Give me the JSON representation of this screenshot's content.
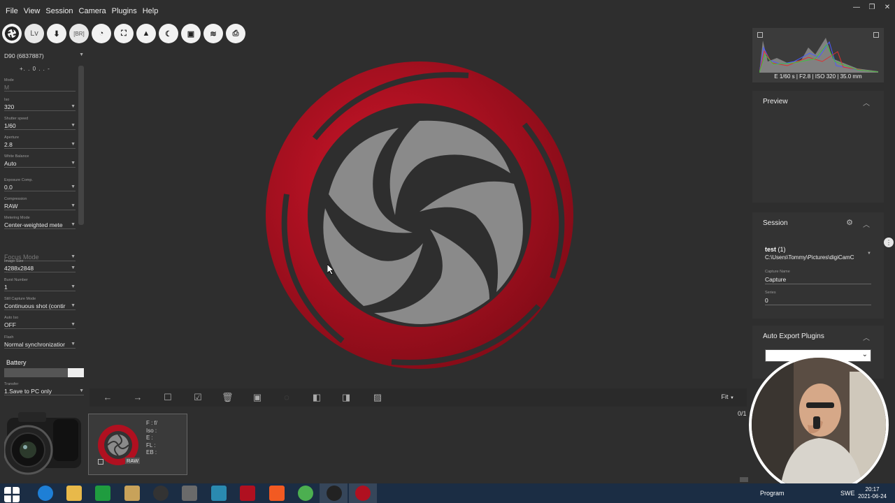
{
  "menu": [
    "File",
    "View",
    "Session",
    "Camera",
    "Plugins",
    "Help"
  ],
  "window_controls": [
    "—",
    "❐",
    "✕"
  ],
  "toolbar": {
    "items": [
      {
        "name": "capture-aperture-icon",
        "label": ""
      },
      {
        "name": "liveview-button",
        "label": "Lv"
      },
      {
        "name": "download-icon",
        "label": "⬇"
      },
      {
        "name": "bracketing-button",
        "label": "[BR]"
      },
      {
        "name": "timelapse-icon",
        "label": "◔"
      },
      {
        "name": "fullscreen-icon",
        "label": "⛶"
      },
      {
        "name": "image-icon",
        "label": "▲"
      },
      {
        "name": "night-mode-icon",
        "label": "☾"
      },
      {
        "name": "gallery-icon",
        "label": "▣"
      },
      {
        "name": "wifi-icon",
        "label": "≋"
      },
      {
        "name": "print-icon",
        "label": "⎙"
      }
    ]
  },
  "camera": {
    "device": "D90 (6837887)",
    "exposure_scale": "+. . 0 . . -",
    "properties": [
      {
        "label": "Mode",
        "value": "M",
        "dim": true
      },
      {
        "label": "Iso",
        "value": "320"
      },
      {
        "label": "Shutter speed",
        "value": "1/60"
      },
      {
        "label": "Aperture",
        "value": "2.8"
      },
      {
        "label": "White Balance",
        "value": "Auto"
      },
      {
        "label": "Exposure Comp.",
        "value": "0.0"
      },
      {
        "label": "Compression",
        "value": "RAW"
      },
      {
        "label": "Metering Mode",
        "value": "Center-weighted mete"
      },
      {
        "label": "",
        "value": "Focus Mode",
        "dim": true
      },
      {
        "label": "Image Size",
        "value": "4288x2848"
      },
      {
        "label": "Burst Number",
        "value": "1"
      },
      {
        "label": "Still Capture Mode",
        "value": "Continuous shot (contir"
      },
      {
        "label": "Auto Iso",
        "value": "OFF"
      },
      {
        "label": "Flash",
        "value": "Normal synchronizatior"
      }
    ],
    "battery_label": "Battery",
    "battery_level": 0.2,
    "transfer_label": "Transfer",
    "transfer_value": "1.Save to PC only"
  },
  "viewer": {
    "fit_label": "Fit",
    "counter": "0/1",
    "thumbnail": {
      "info": [
        "F : f/",
        "Iso :",
        "E :",
        "FL :",
        "EB :"
      ],
      "badge": "RAW"
    }
  },
  "histogram": {
    "caption": "E 1/60 s | F2.8 | ISO 320 | 35.0 mm"
  },
  "preview": {
    "title": "Preview"
  },
  "session": {
    "title": "Session",
    "name": "test",
    "count": "(1)",
    "path": "C:\\Users\\Tommy\\Pictures\\digiCamC",
    "capture_name_label": "Capture Name",
    "capture_name": "Capture",
    "series_label": "Series",
    "series": "0"
  },
  "auto_export": {
    "title": "Auto Export Plugins"
  },
  "taskbar": {
    "program_label": "Program",
    "lang": "SWE",
    "time": "20:17",
    "date": "2021-06-24"
  },
  "colors": {
    "accent_red": "#b01020",
    "logo_gray": "#8a8a8a"
  }
}
